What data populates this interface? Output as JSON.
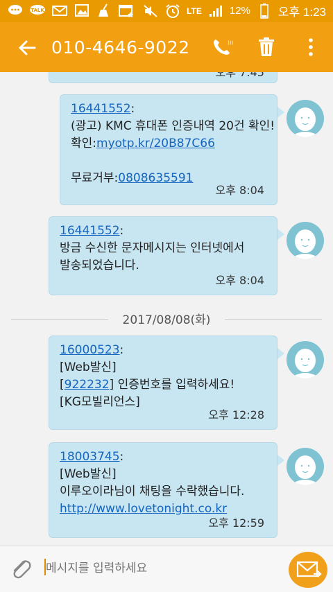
{
  "status_bar": {
    "battery": "12%",
    "time": "오후 1:23",
    "network": "LTE",
    "icons": [
      "chat-bubbles-icon",
      "talk-icon",
      "mail-icon",
      "image-icon",
      "broom-icon",
      "calendar-icon",
      "mute-icon",
      "alarm-icon",
      "signal-icon",
      "battery-icon"
    ]
  },
  "header": {
    "title": "010-4646-9022",
    "buttons": [
      "call-icon",
      "delete-icon",
      "more-icon"
    ]
  },
  "partial_time": "오후 7:45",
  "messages": [
    {
      "sender": "16441552",
      "lines": [
        "(광고) KMC 휴대폰 인증내역 20건 확인!"
      ],
      "link_line_prefix": "확인:",
      "link": "myotp.kr/20B87C66",
      "optout_prefix": "무료거부:",
      "optout_number": "0808635591",
      "time": "오후 8:04"
    },
    {
      "sender": "16441552",
      "lines": [
        "방금 수신한 문자메시지는 인터넷에서",
        "발송되었습니다."
      ],
      "time": "오후 8:04"
    },
    {
      "sender": "16000523",
      "line1": "[Web발신]",
      "code": "922232",
      "code_suffix": "] 인증번호를 입력하세요!",
      "line3": "[KG모빌리언스]",
      "time": "오후 12:28"
    },
    {
      "sender": "18003745",
      "line1": "[Web발신]",
      "line2": "이루오이라님이 채팅을 수락했습니다.",
      "link": "http://www.lovetonight.co.kr",
      "time": "오후 12:59"
    }
  ],
  "date_separator": "2017/08/08(화)",
  "compose": {
    "placeholder": "메시지를 입력하세요"
  },
  "colors": {
    "header": "#f2a011",
    "status_bar": "#e89a00",
    "bubble": "#c8e6f2",
    "link": "#1565c0",
    "avatar": "#7fc3d2"
  }
}
